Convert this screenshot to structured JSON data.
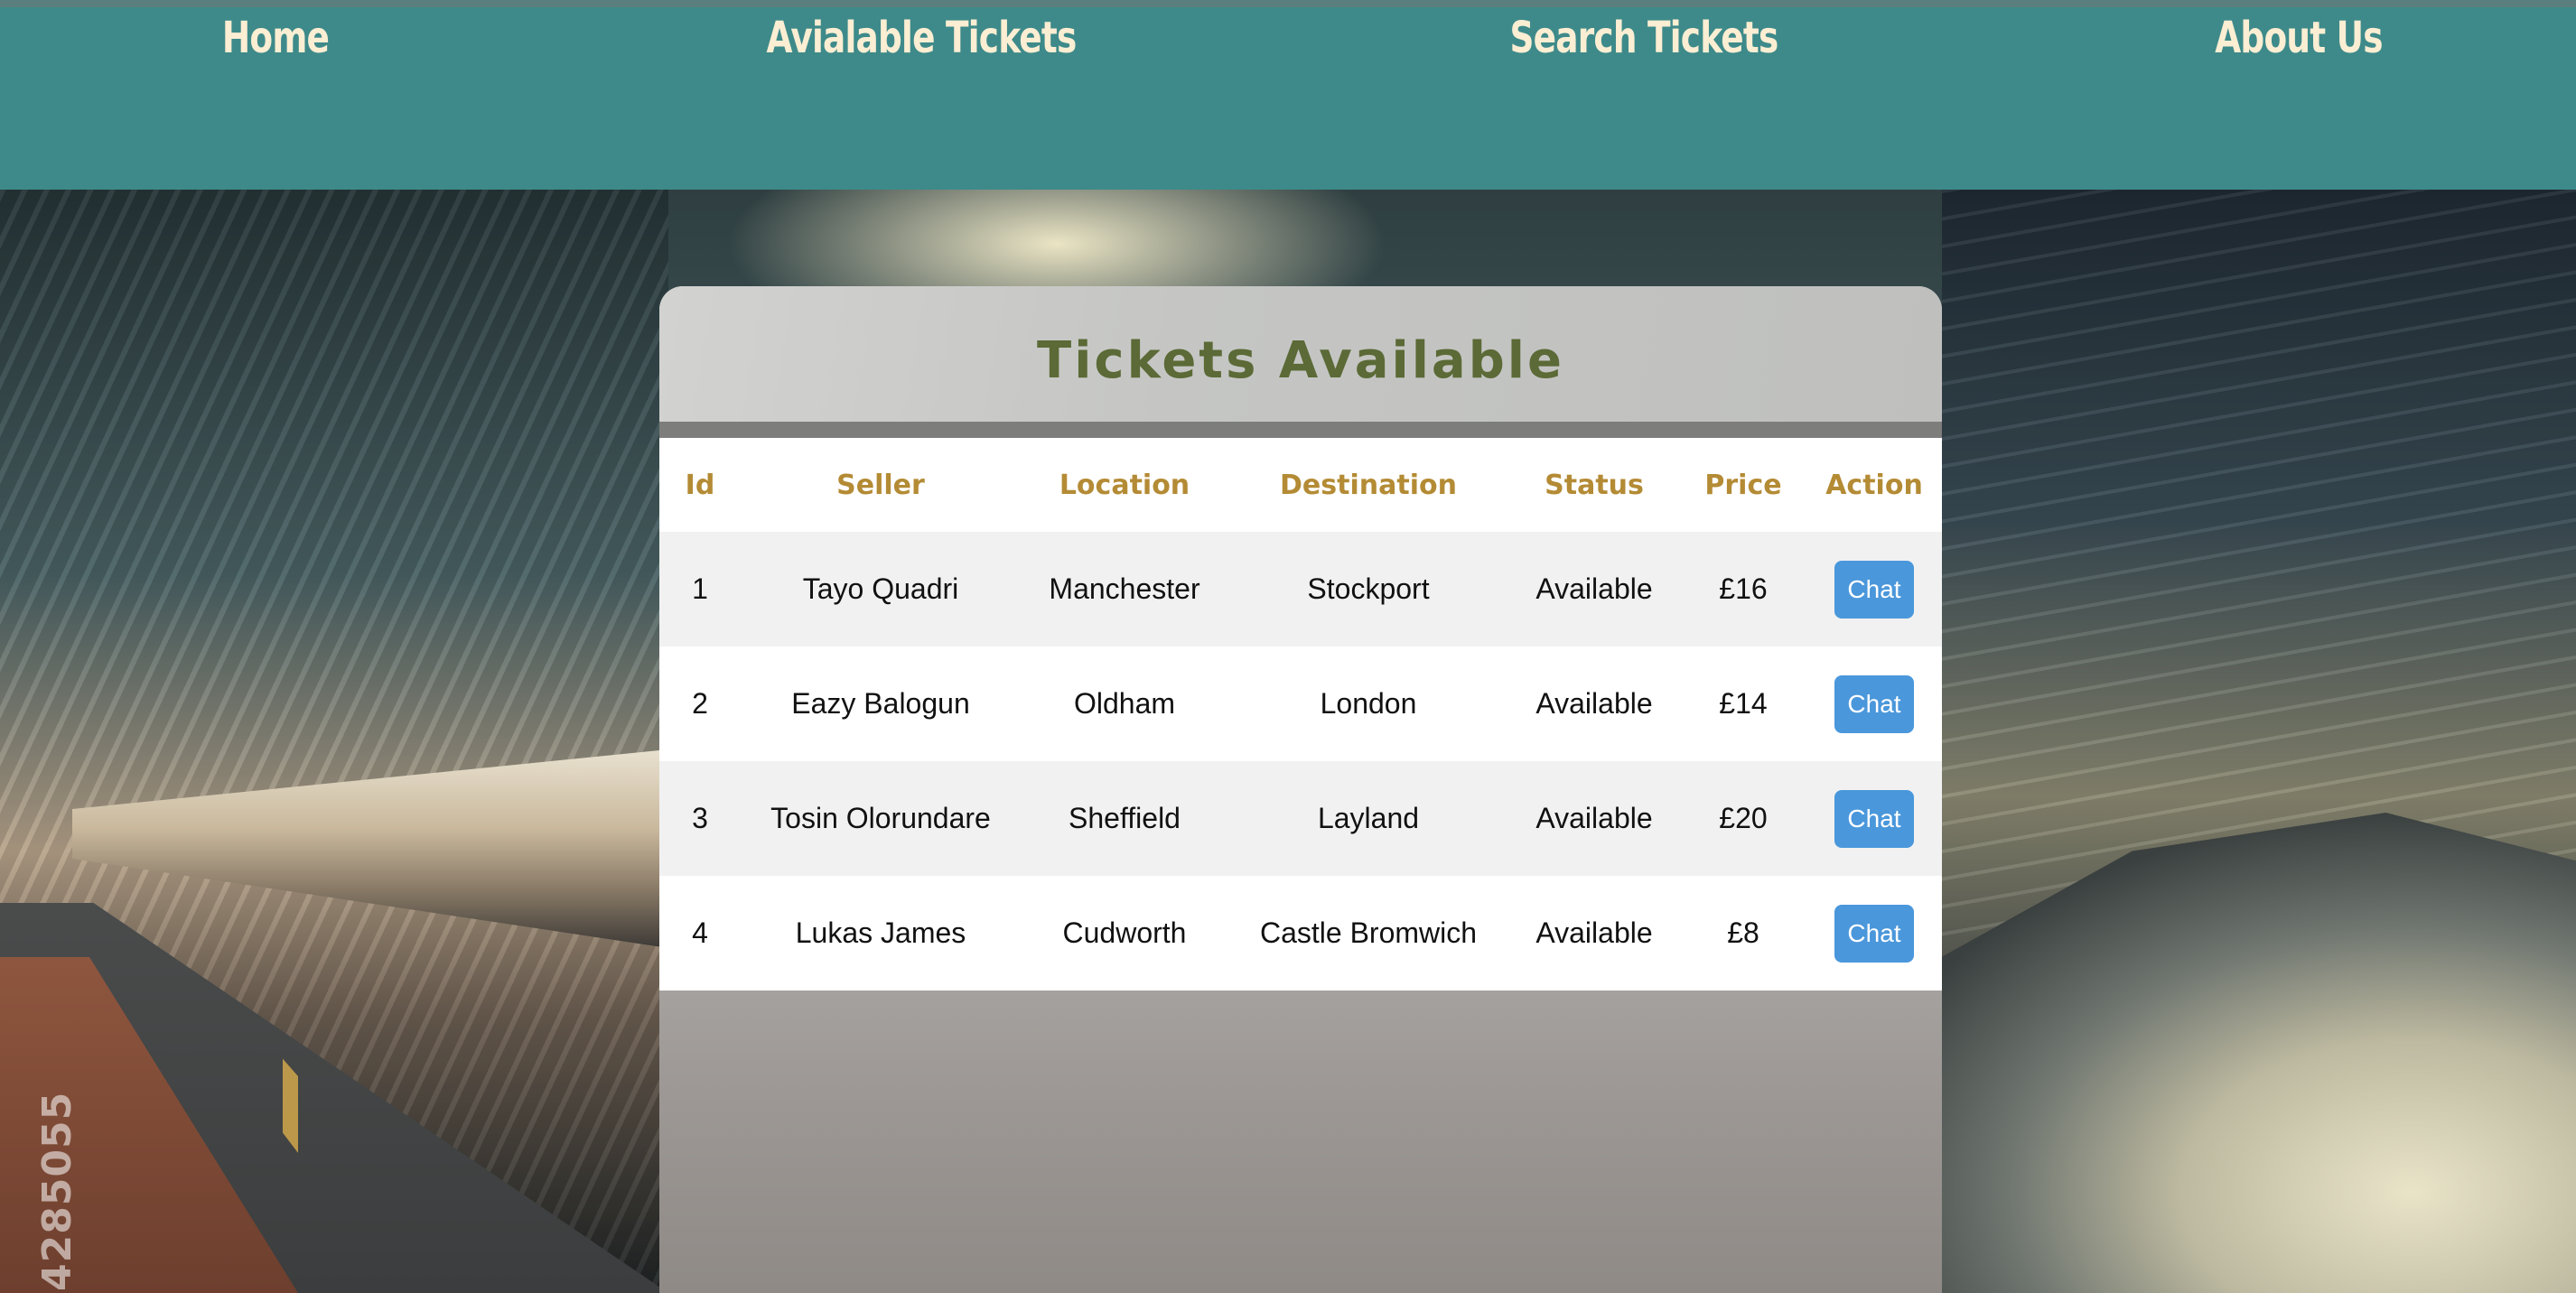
{
  "nav": {
    "home": "Home",
    "available": "Avialable Tickets",
    "search": "Search Tickets",
    "about": "About Us"
  },
  "background": {
    "watermark_number": "4285055"
  },
  "card": {
    "title": "Tickets Available"
  },
  "table": {
    "headers": [
      "Id",
      "Seller",
      "Location",
      "Destination",
      "Status",
      "Price",
      "Action"
    ],
    "rows": [
      {
        "id": "1",
        "seller": "Tayo Quadri",
        "location": "Manchester",
        "destination": "Stockport",
        "status": "Available",
        "price": "£16",
        "action": "Chat"
      },
      {
        "id": "2",
        "seller": "Eazy Balogun",
        "location": "Oldham",
        "destination": "London",
        "status": "Available",
        "price": "£14",
        "action": "Chat"
      },
      {
        "id": "3",
        "seller": "Tosin Olorundare",
        "location": "Sheffield",
        "destination": "Layland",
        "status": "Available",
        "price": "£20",
        "action": "Chat"
      },
      {
        "id": "4",
        "seller": "Lukas James",
        "location": "Cudworth",
        "destination": "Castle Bromwich",
        "status": "Available",
        "price": "£8",
        "action": "Chat"
      }
    ]
  },
  "colors": {
    "nav_bg": "#3e8a8a",
    "nav_text": "#fbeed3",
    "title_text": "#5b6a36",
    "header_text": "#b48b35",
    "button_bg": "#4a97db"
  }
}
